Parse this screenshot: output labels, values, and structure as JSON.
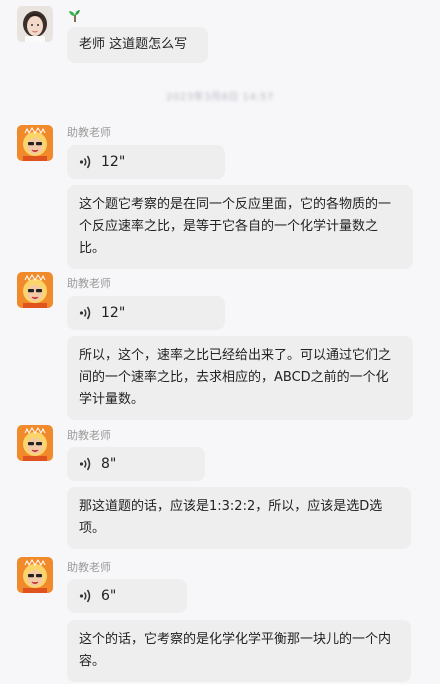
{
  "colors": {
    "background": "#f7f7f9",
    "bubble": "#eeeeef",
    "name_text": "#9a9a9a",
    "assistant_avatar_bg": "#f08a2a"
  },
  "student": {
    "badge_icon": "sprout-icon",
    "message": "老师 这道题怎么写"
  },
  "timestamp": "2023年3月8日 14:57",
  "assistant_name": "助教老师",
  "messages": [
    {
      "voice_duration": "12\"",
      "text": "这个题它考察的是在同一个反应里面，它的各物质的一个反应速率之比，是等于它各自的一个化学计量数之比。"
    },
    {
      "voice_duration": "12\"",
      "text": "所以，这个，速率之比已经给出来了。可以通过它们之间的一个速率之比，去求相应的，ABCD之前的一个化学计量数。"
    },
    {
      "voice_duration": "8\"",
      "text": "那这道题的话，应该是1:3:2:2，所以，应该是选D选项。"
    },
    {
      "voice_duration": "6\"",
      "text": "这个的话，它考察的是化学化学平衡那一块儿的一个内容。"
    }
  ]
}
